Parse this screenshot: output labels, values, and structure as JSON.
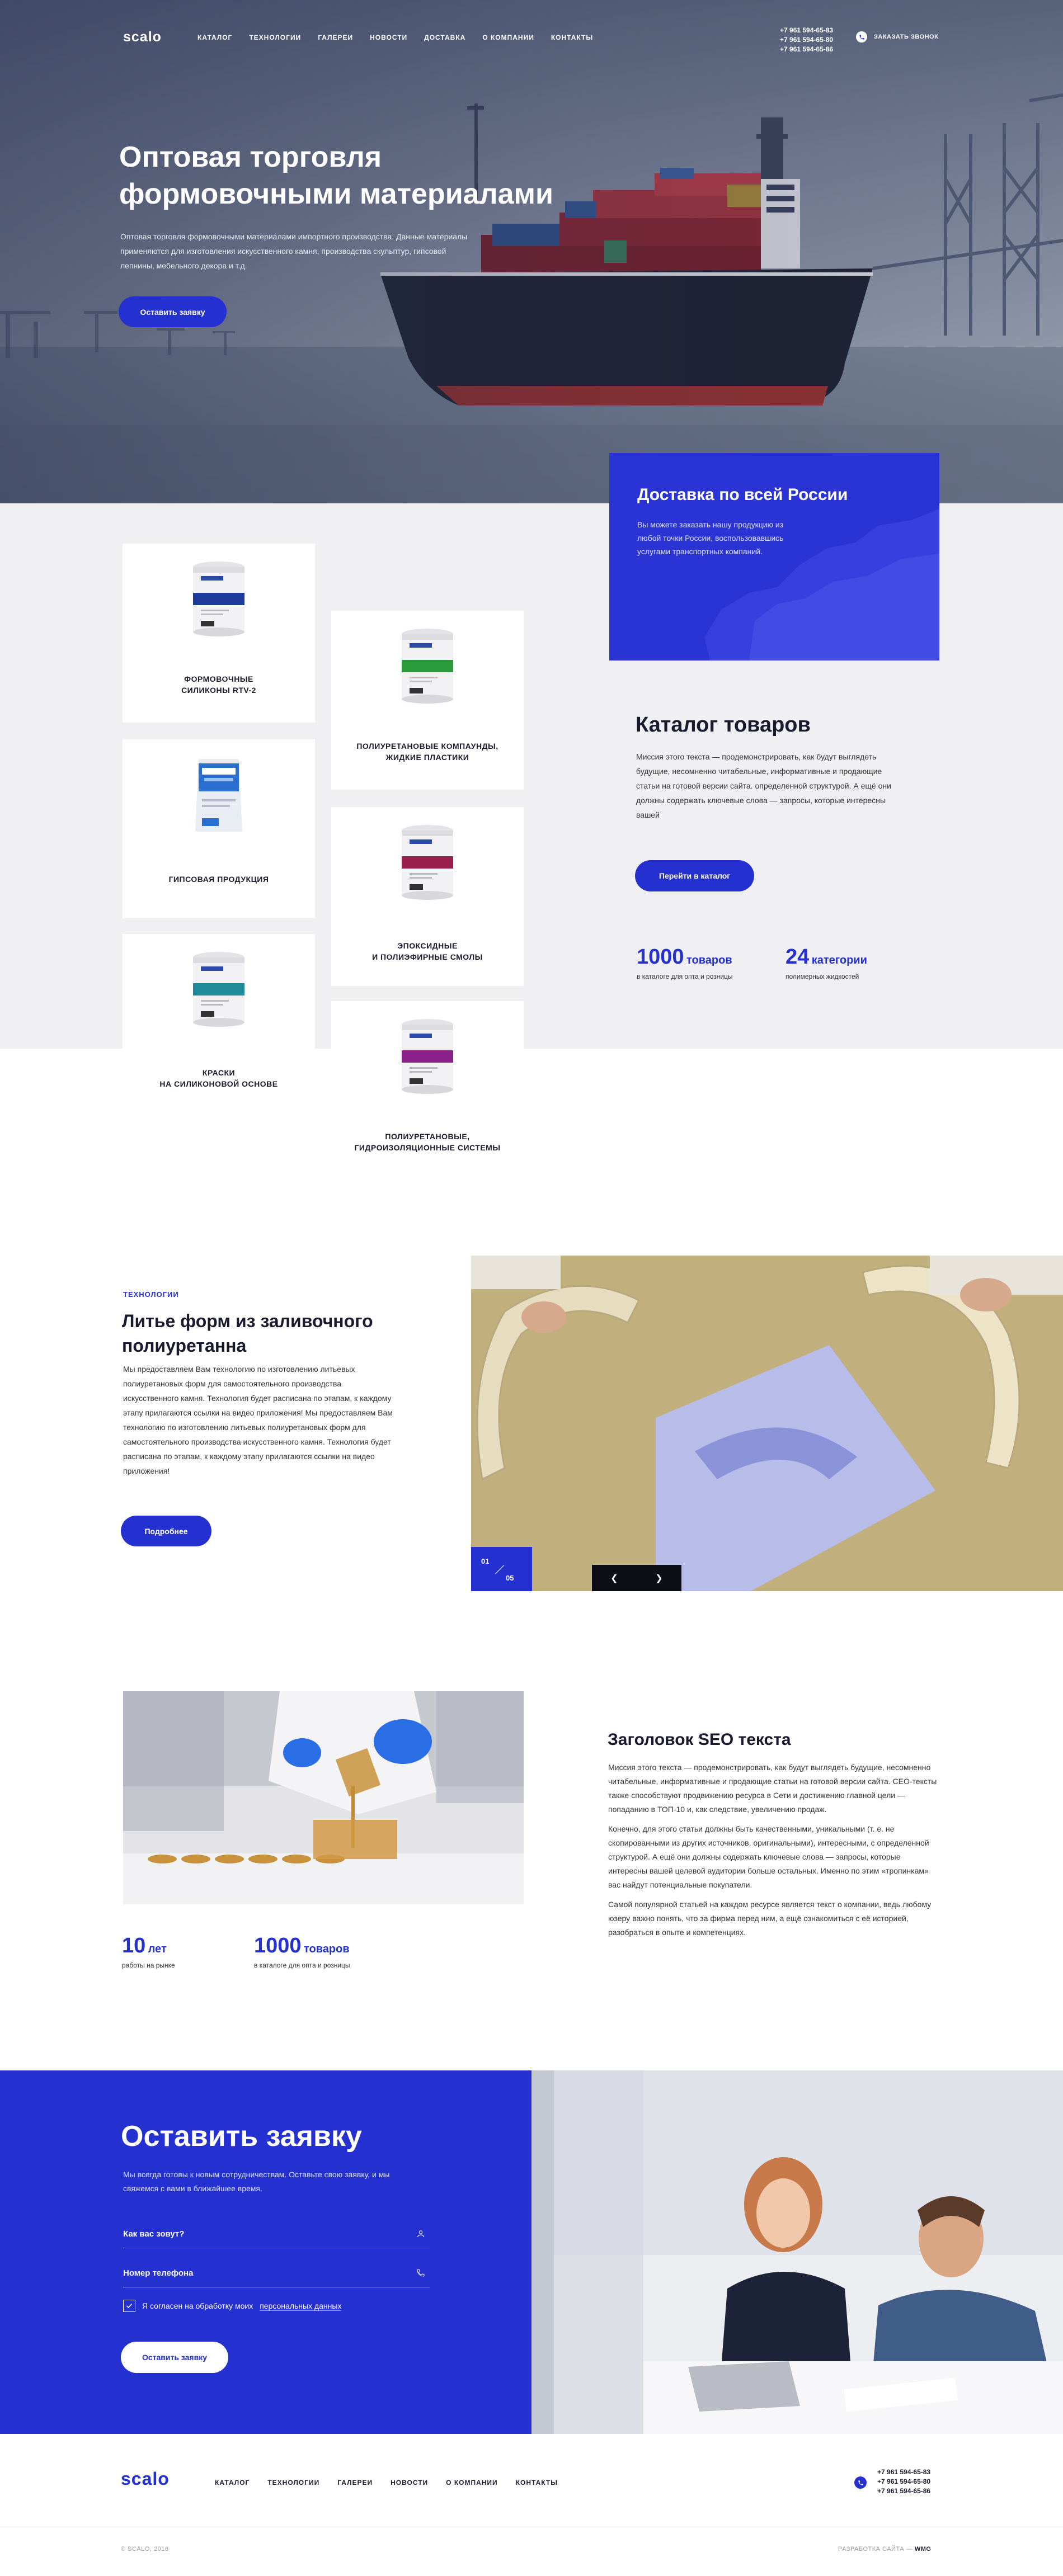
{
  "header": {
    "logo": "scalo",
    "menu": [
      "КАТАЛОГ",
      "ТЕХНОЛОГИИ",
      "ГАЛЕРЕИ",
      "НОВОСТИ",
      "ДОСТАВКА",
      "О КОМПАНИИ",
      "КОНТАКТЫ"
    ],
    "phones": [
      "+7 961 594-65-83",
      "+7 961 594-65-80",
      "+7 961 594-65-86"
    ],
    "callback_label": "ЗАКАЗАТЬ ЗВОНОК"
  },
  "hero": {
    "title_line1": "Оптовая торговля",
    "title_line2": "формовочными материалами",
    "text": "Оптовая торговля формовочными материалами импортного производства. Данные материалы применяются для изготовления искусственного камня, производства скульптур, гипсовой лепнины, мебельного декора и т.д.",
    "button": "Оставить заявку"
  },
  "products": [
    {
      "line1": "ФОРМОВОЧНЫЕ",
      "line2": "СИЛИКОНЫ RTV-2",
      "accent": "#1e3a9a"
    },
    {
      "line1": "ПОЛИУРЕТАНОВЫЕ КОМПАУНДЫ,",
      "line2": "ЖИДКИЕ ПЛАСТИКИ",
      "accent": "#2b9a3a"
    },
    {
      "line1": "ГИПСОВАЯ ПРОДУКЦИЯ",
      "line2": "",
      "accent": "#2a6fd0"
    },
    {
      "line1": "ЭПОКСИДНЫЕ",
      "line2": "И ПОЛИЭФИРНЫЕ СМОЛЫ",
      "accent": "#9a1e4a"
    },
    {
      "line1": "КРАСКИ",
      "line2": "НА СИЛИКОНОВОЙ ОСНОВЕ",
      "accent": "#1e8a9a"
    },
    {
      "line1": "ПОЛИУРЕТАНОВЫЕ,",
      "line2": "ГИДРОИЗОЛЯЦИОННЫЕ СИСТЕМЫ",
      "accent": "#8a1e8a"
    }
  ],
  "delivery": {
    "title": "Доставка по всей России",
    "text": "Вы можете заказать нашу продукцию из любой точки России, воспользовавшись услугами транспортных компаний."
  },
  "catalog": {
    "title": "Каталог товаров",
    "text": "Миссия этого текста — продемонстрировать, как будут выглядеть будущие, несомненно читабельные, информативные и продающие статьи на готовой версии сайта. определенной структурой. А ещё они должны содержать ключевые слова — запросы, которые интересны вашей",
    "button": "Перейти в каталог",
    "stat1_num": "1000",
    "stat1_unit": "товаров",
    "stat1_caption": "в каталоге для опта и розницы",
    "stat2_num": "24",
    "stat2_unit": "категории",
    "stat2_caption": "полимерных жидкостей"
  },
  "technology": {
    "tag": "ТЕХНОЛОГИИ",
    "title": "Литье форм из заливочного полиуретанна",
    "text": "Мы предоставляем Вам технологию по изготовлению литьевых полиуретановых форм для самостоятельного производства искусственного камня. Технология будет расписана по этапам, к каждому этапу прилагаются ссылки на видео приложения! Мы предоставляем Вам технологию по изготовлению литьевых полиуретановых форм для самостоятельного производства искусственного камня. Технология будет расписана по этапам, к каждому этапу прилагаются ссылки на видео приложения!",
    "button": "Подробнее",
    "slide_current": "01",
    "slide_total": "05"
  },
  "seo": {
    "title": "Заголовок SEO текста",
    "p1": "Миссия этого текста — продемонстрировать, как будут выглядеть будущие, несомненно читабельные, информативные и продающие статьи на готовой версии сайта. СЕО-тексты также способствуют продвижению ресурса в Сети и достижению главной цели — попаданию в ТОП-10 и, как следствие, увеличению продаж.",
    "p2": "Конечно, для этого статьи должны быть качественными, уникальными (т. е. не скопированными из других источников, оригинальными), интересными, с определенной структурой. А ещё они должны содержать ключевые слова — запросы, которые интересны вашей целевой аудитории больше остальных. Именно по этим «тропинкам» вас найдут потенциальные покупатели.",
    "p3": "Самой популярной статьей на каждом ресурсе является текст о компании, ведь любому юзеру важно понять, что за фирма перед ним, а ещё ознакомиться с её историей, разобраться в опыте и компетенциях.",
    "stat1_num": "10",
    "stat1_unit": "лет",
    "stat1_caption": "работы на рынке",
    "stat2_num": "1000",
    "stat2_unit": "товаров",
    "stat2_caption": "в каталоге для опта и розницы"
  },
  "request": {
    "title": "Оставить заявку",
    "text": "Мы всегда готовы к новым сотрудничествам. Оставьте свою заявку, и мы свяжемся с вами в ближайшее время.",
    "name_placeholder": "Как вас зовут?",
    "phone_placeholder": "Номер телефона",
    "consent_prefix": "Я согласен на обработку моих",
    "consent_link": "персональных данных",
    "button": "Оставить заявку"
  },
  "footer": {
    "logo": "scalo",
    "menu": [
      "КАТАЛОГ",
      "ТЕХНОЛОГИИ",
      "ГАЛЕРЕИ",
      "НОВОСТИ",
      "О КОМПАНИИ",
      "КОНТАКТЫ"
    ],
    "phones": [
      "+7 961 594-65-83",
      "+7 961 594-65-80",
      "+7 961 594-65-86"
    ],
    "copyright": "© SCALO, 2018",
    "dev_prefix": "РАЗРАБОТКА САЙТА —",
    "dev_name": "WMG"
  },
  "colors": {
    "accent": "#2430d0",
    "panel": "#2a33d4",
    "light_bg": "#f0f0f2"
  }
}
